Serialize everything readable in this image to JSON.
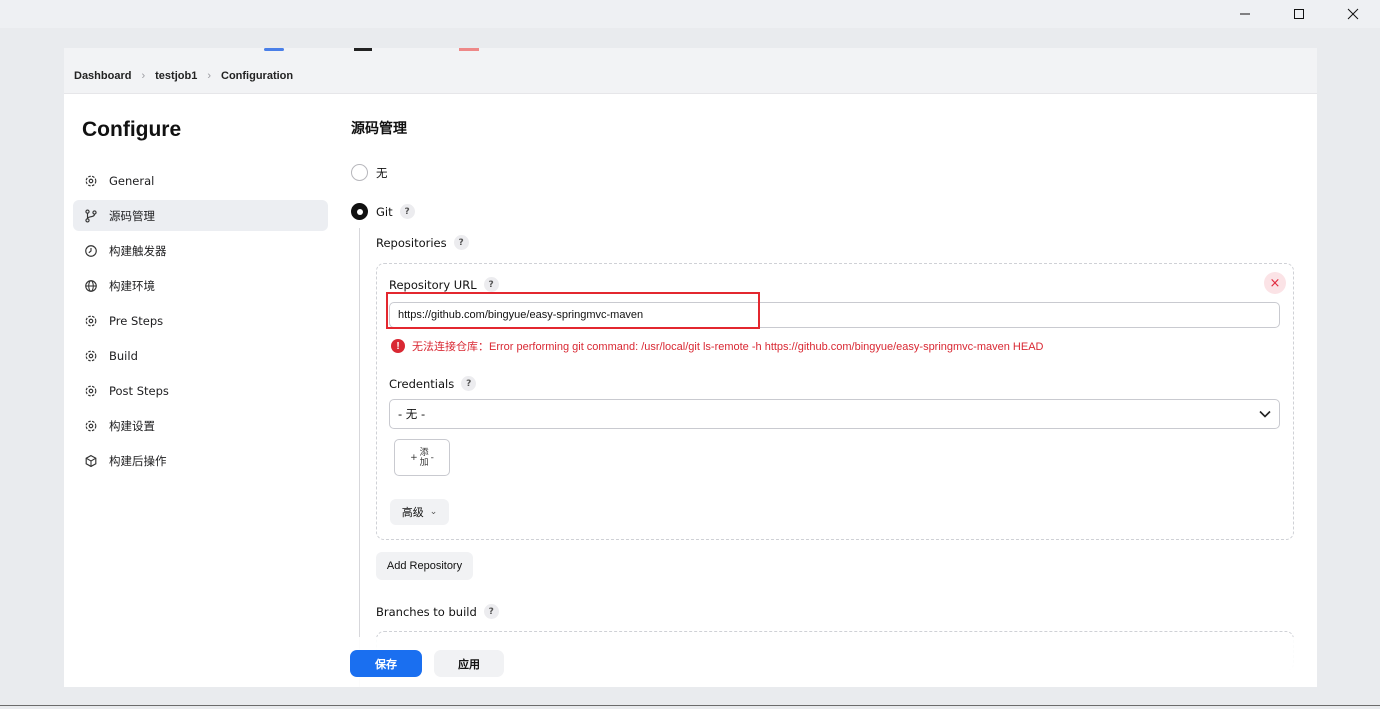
{
  "window": {
    "minimize_icon": "minimize-icon",
    "maximize_icon": "maximize-icon",
    "close_icon": "close-icon"
  },
  "breadcrumb": [
    "Dashboard",
    "testjob1",
    "Configuration"
  ],
  "sidebar": {
    "title": "Configure",
    "items": [
      {
        "label": "General",
        "icon": "gear-icon"
      },
      {
        "label": "源码管理",
        "icon": "branch-icon"
      },
      {
        "label": "构建触发器",
        "icon": "clock-icon"
      },
      {
        "label": "构建环境",
        "icon": "globe-icon"
      },
      {
        "label": "Pre Steps",
        "icon": "gear-icon"
      },
      {
        "label": "Build",
        "icon": "gear-icon"
      },
      {
        "label": "Post Steps",
        "icon": "gear-icon"
      },
      {
        "label": "构建设置",
        "icon": "gear-icon"
      },
      {
        "label": "构建后操作",
        "icon": "box-icon"
      }
    ]
  },
  "scm": {
    "title": "源码管理",
    "option_none": "无",
    "option_git": "Git",
    "help": "?",
    "repositories_label": "Repositories",
    "repository_url_label": "Repository URL",
    "repository_url_value": "https://github.com/bingyue/easy-springmvc-maven",
    "error_message": "无法连接仓库：Error performing git command: /usr/local/git ls-remote -h https://github.com/bingyue/easy-springmvc-maven HEAD",
    "credentials_label": "Credentials",
    "credentials_value": "- 无 -",
    "add_prefix": "+",
    "add_top": "添",
    "add_bottom": "加",
    "add_suffix": "-",
    "advanced_label": "高级",
    "add_repository_label": "Add Repository",
    "branches_label": "Branches to build"
  },
  "footer": {
    "save_label": "保存",
    "apply_label": "应用"
  },
  "colors": {
    "primary": "#1a6ff0",
    "error": "#d92833",
    "highlight": "#e3272f"
  }
}
